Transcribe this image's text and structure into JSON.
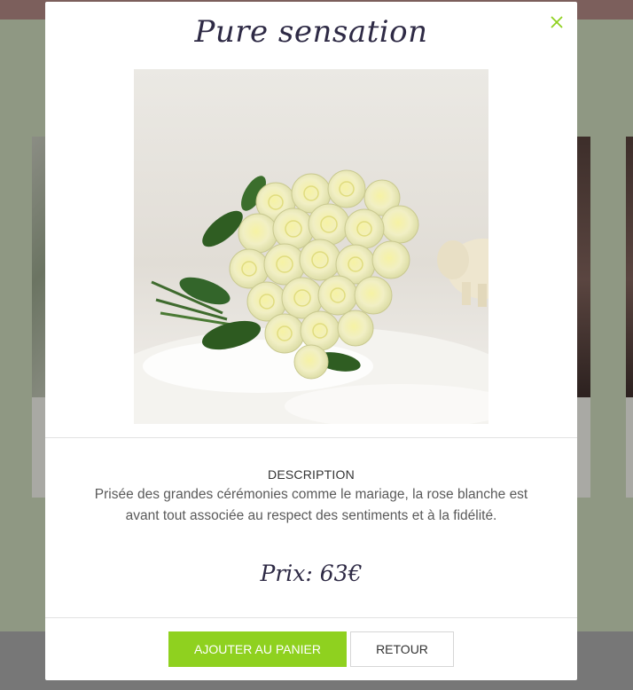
{
  "modal": {
    "title": "Pure sensation",
    "close_icon": "close-icon",
    "image_alt": "Bouquet de roses blanches",
    "description_heading": "DESCRIPTION",
    "description_text": "Prisée des grandes cérémonies comme le mariage, la rose blanche est avant tout associée au respect des sentiments et à la fidélité.",
    "price": "Prix: 63€",
    "add_to_cart_label": "AJOUTER AU PANIER",
    "back_label": "RETOUR"
  },
  "colors": {
    "accent": "#8fd11f",
    "title": "#2e2a45",
    "overlay_bg": "#8f9883"
  }
}
